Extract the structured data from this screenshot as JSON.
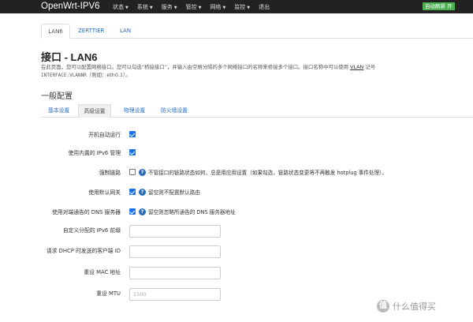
{
  "navbar": {
    "brand": "OpenWrt-IPV6",
    "menu": [
      "状态",
      "系统",
      "服务",
      "管控",
      "网络",
      "监控",
      "退出"
    ],
    "refresh_label": "自动刷新 开",
    "refresh_color": "#4caf50"
  },
  "interface_tabs": [
    "LAN6",
    "ZERTTIER",
    "LAN"
  ],
  "page": {
    "title": "接口 - LAN6",
    "desc_line1_a": "在此页面，您可以配置网络接口。您可以勾选“桥接接口”，并输入由空格分隔的多个网络接口的名称来桥接多个接口。接口名称中可以使用 ",
    "desc_vlan": "VLAN",
    "desc_line1_b": " 记号",
    "desc_line2_code": "INTERFACE.VLANNR",
    "desc_line2_rest": "（例如：eth0.1）。"
  },
  "section_title": "一般配置",
  "config_tabs": [
    "基本设置",
    "高级设置",
    "物理设置",
    "防火墙设置"
  ],
  "fields": {
    "auto_start": {
      "label": "开机自动运行"
    },
    "builtin_ipv6": {
      "label": "使用内置的 IPv6 管理"
    },
    "force_link": {
      "label": "强制链路",
      "hint": "不管接口的链路状态如何，总是用应用设置（如果勾选，链路状态变更将不再触发 hotplug 事件处理）。"
    },
    "default_gateway": {
      "label": "使用默认网关",
      "hint": "留空则不配置默认路由"
    },
    "peer_dns": {
      "label": "使用对端通告的 DNS 服务器",
      "hint": "留空则忽略所通告的 DNS 服务器地址"
    },
    "ipv6_prefix": {
      "label": "自定义分配的 IPv6 前缀",
      "value": ""
    },
    "dhcp_client_id": {
      "label": "请求 DHCP 时发送的客户端 ID",
      "value": ""
    },
    "mac_override": {
      "label": "重设 MAC 地址",
      "value": ""
    },
    "mtu_override": {
      "label": "重设 MTU",
      "value": "",
      "placeholder": "1500"
    }
  },
  "watermark": {
    "logo": "值",
    "text": "什么值得买"
  },
  "colors": {
    "navbar": "#222222",
    "accent": "#1a73e8",
    "link": "#2a6ebd"
  }
}
